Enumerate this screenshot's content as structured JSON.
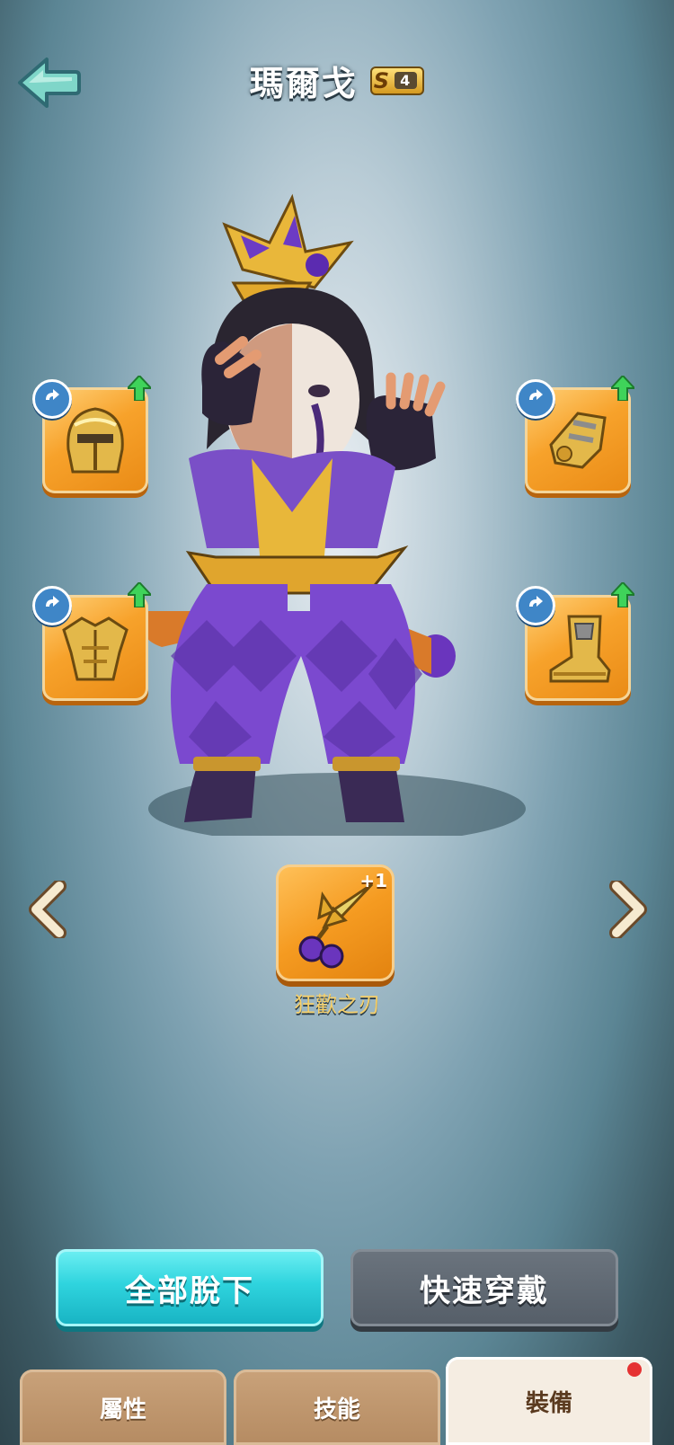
{
  "header": {
    "title": "瑪爾戈",
    "rank_letter": "S",
    "rank_number": "4"
  },
  "equipment": {
    "helmet": {
      "icon": "helmet-icon",
      "upgrade_available": true
    },
    "gloves": {
      "icon": "gauntlet-icon",
      "upgrade_available": true
    },
    "armor": {
      "icon": "chest-armor-icon",
      "upgrade_available": true
    },
    "boots": {
      "icon": "boot-icon",
      "upgrade_available": true
    }
  },
  "weapon": {
    "name": "狂歡之刃",
    "enhance": "+1",
    "icon": "jester-blade-icon"
  },
  "buttons": {
    "unequip_all": "全部脫下",
    "quick_equip": "快速穿戴"
  },
  "tabs": [
    {
      "label": "屬性",
      "active": false
    },
    {
      "label": "技能",
      "active": false
    },
    {
      "label": "裝備",
      "active": true,
      "notification": true
    }
  ],
  "colors": {
    "accent_cyan": "#2fd4de",
    "slot_orange": "#f7a22b",
    "weapon_name": "#f5cf6a",
    "notify_red": "#e53232"
  }
}
